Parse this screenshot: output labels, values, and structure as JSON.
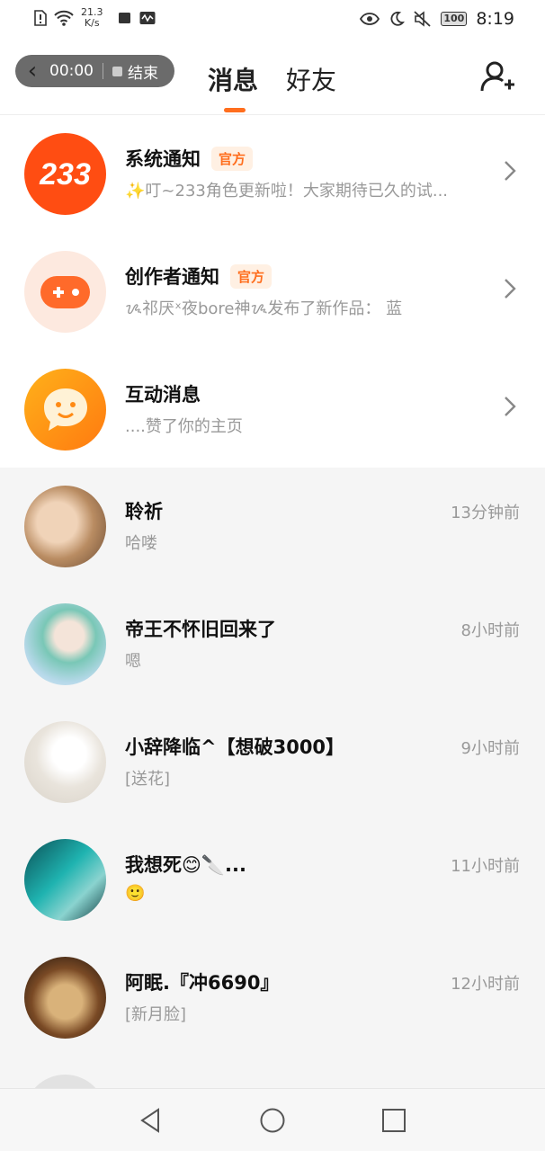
{
  "status_bar": {
    "net_speed_value": "21.3",
    "net_speed_unit": "K/s",
    "battery": "100",
    "time": "8:19"
  },
  "header": {
    "timer": "00:00",
    "end_label": "结束",
    "tabs": [
      {
        "label": "消息",
        "active": true
      },
      {
        "label": "好友",
        "active": false
      }
    ]
  },
  "official": [
    {
      "name": "系统通知",
      "badge": "官方",
      "preview": "✨叮~233角色更新啦！大家期待已久的试..."
    },
    {
      "name": "创作者通知",
      "badge": "官方",
      "preview": "ᝰ祁厌ˣ夜bore神ᝰ发布了新作品：  蓝"
    },
    {
      "name": "互动消息",
      "badge": "",
      "preview": "....赞了你的主页"
    }
  ],
  "logo_text": "233",
  "conversations": [
    {
      "name": "聆祈",
      "preview": "哈喽",
      "time": "13分钟前"
    },
    {
      "name": "帝王不怀旧回来了",
      "preview": "嗯",
      "time": "8小时前"
    },
    {
      "name": "小辞降临^【想破3000】",
      "preview": "[送花]",
      "time": "9小时前"
    },
    {
      "name": "我想死😊🔪...",
      "preview": "🙂",
      "time": "11小时前"
    },
    {
      "name": "阿眠.『冲6690』",
      "preview": "[新月脸]",
      "time": "12小时前"
    },
    {
      "name": "",
      "preview": "",
      "time": ""
    }
  ],
  "colors": {
    "accent": "#ff6e1e",
    "badge_bg": "#fff0e3"
  }
}
